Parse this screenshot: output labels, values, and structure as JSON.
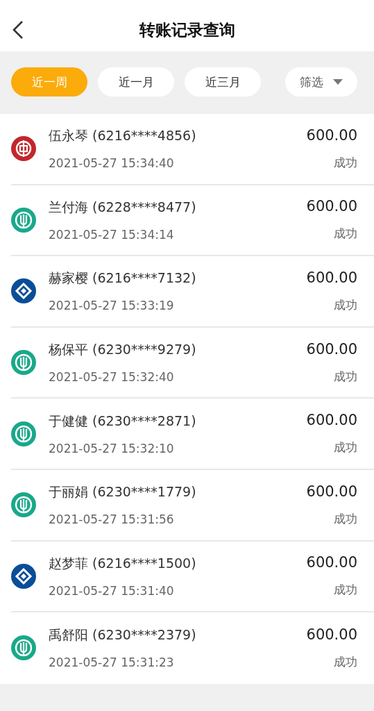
{
  "header": {
    "title": "转账记录查询"
  },
  "filters": [
    {
      "label": "近一周",
      "selected": true
    },
    {
      "label": "近一月",
      "selected": false
    },
    {
      "label": "近三月",
      "selected": false
    }
  ],
  "filter_menu": {
    "label": "筛选"
  },
  "records": [
    {
      "kind": "coin",
      "payee": "伍永琴 (6216****4856)",
      "time": "2021-05-27 15:34:40",
      "amount": "600.00",
      "status": "成功"
    },
    {
      "kind": "wheat",
      "payee": "兰付海 (6228****8477)",
      "time": "2021-05-27 15:34:14",
      "amount": "600.00",
      "status": "成功"
    },
    {
      "kind": "arc",
      "payee": "赫家樱 (6216****7132)",
      "time": "2021-05-27 15:33:19",
      "amount": "600.00",
      "status": "成功"
    },
    {
      "kind": "wheat",
      "payee": "杨保平 (6230****9279)",
      "time": "2021-05-27 15:32:40",
      "amount": "600.00",
      "status": "成功"
    },
    {
      "kind": "wheat",
      "payee": "于健健 (6230****2871)",
      "time": "2021-05-27 15:32:10",
      "amount": "600.00",
      "status": "成功"
    },
    {
      "kind": "wheat",
      "payee": "于丽娟 (6230****1779)",
      "time": "2021-05-27 15:31:56",
      "amount": "600.00",
      "status": "成功"
    },
    {
      "kind": "arc",
      "payee": "赵梦菲 (6216****1500)",
      "time": "2021-05-27 15:31:40",
      "amount": "600.00",
      "status": "成功"
    },
    {
      "kind": "wheat",
      "payee": "禹舒阳 (6230****2379)",
      "time": "2021-05-27 15:31:23",
      "amount": "600.00",
      "status": "成功"
    }
  ]
}
